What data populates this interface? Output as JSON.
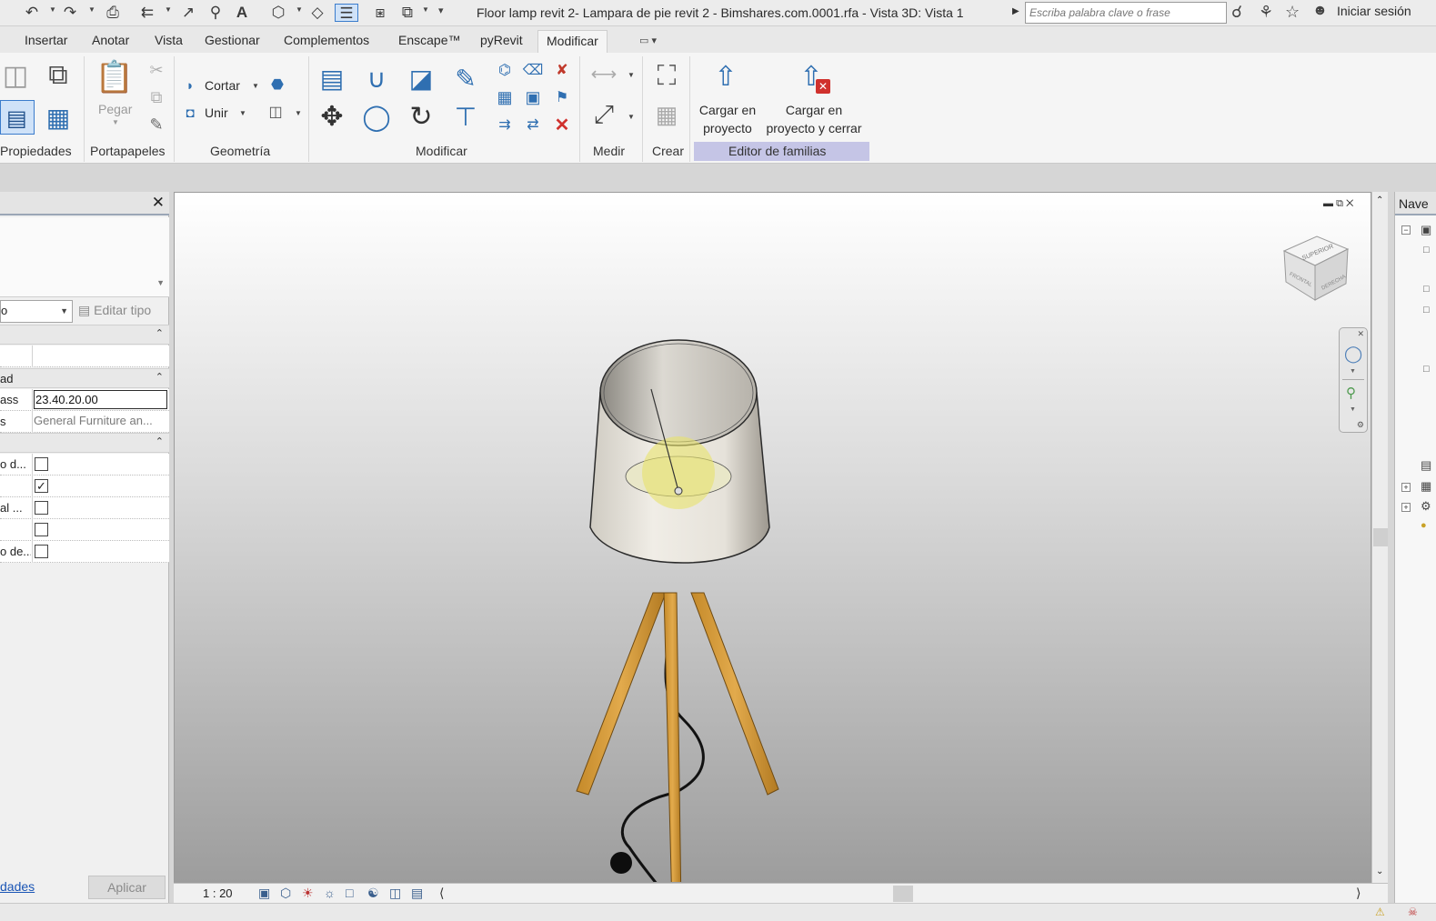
{
  "title_bar": {
    "title": "Floor lamp revit 2- Lampara de pie revit 2 - Bimshares.com.0001.rfa - Vista 3D: Vista 1",
    "search_placeholder": "Escriba palabra clave o frase",
    "signin_label": "Iniciar sesión"
  },
  "tabs": [
    {
      "label": "Insertar"
    },
    {
      "label": "Anotar"
    },
    {
      "label": "Vista"
    },
    {
      "label": "Gestionar"
    },
    {
      "label": "Complementos"
    },
    {
      "label": "Enscape™"
    },
    {
      "label": "pyRevit"
    },
    {
      "label": "Modificar",
      "active": true
    }
  ],
  "ribbon": {
    "panels": {
      "properties": "Propiedades",
      "clipboard": "Portapapeles",
      "geometry": "Geometría",
      "modify": "Modificar",
      "measure": "Medir",
      "create": "Crear",
      "family_editor": "Editor de familias"
    },
    "paste_label": "Pegar",
    "cut_label": "Cortar",
    "join_label": "Unir",
    "load_project_label": "Cargar en proyecto",
    "load_project_close_label": "Cargar en proyecto y cerrar",
    "family_editor_color": "#c5c5e6"
  },
  "properties_palette": {
    "filter_value": "o",
    "edit_type_label": "Editar tipo",
    "section_2_label": "ad",
    "rows": [
      {
        "name": "ass",
        "value": "23.40.20.00"
      },
      {
        "name": "s",
        "value": "General Furniture an..."
      }
    ],
    "checkbox_rows": [
      {
        "name": "o d...",
        "checked": false
      },
      {
        "name": "",
        "checked": true
      },
      {
        "name": "al ...",
        "checked": false
      },
      {
        "name": "",
        "checked": false
      },
      {
        "name": "o de...",
        "checked": false
      }
    ],
    "link_label": "dades",
    "apply_label": "Aplicar"
  },
  "viewport": {
    "viewcube_top_label": "SUPERIOR",
    "viewcube_front_label": "FRONTAL",
    "viewcube_right_label": "DERECHA",
    "scale_label": "1 : 20"
  },
  "project_browser": {
    "title": "Nave"
  }
}
